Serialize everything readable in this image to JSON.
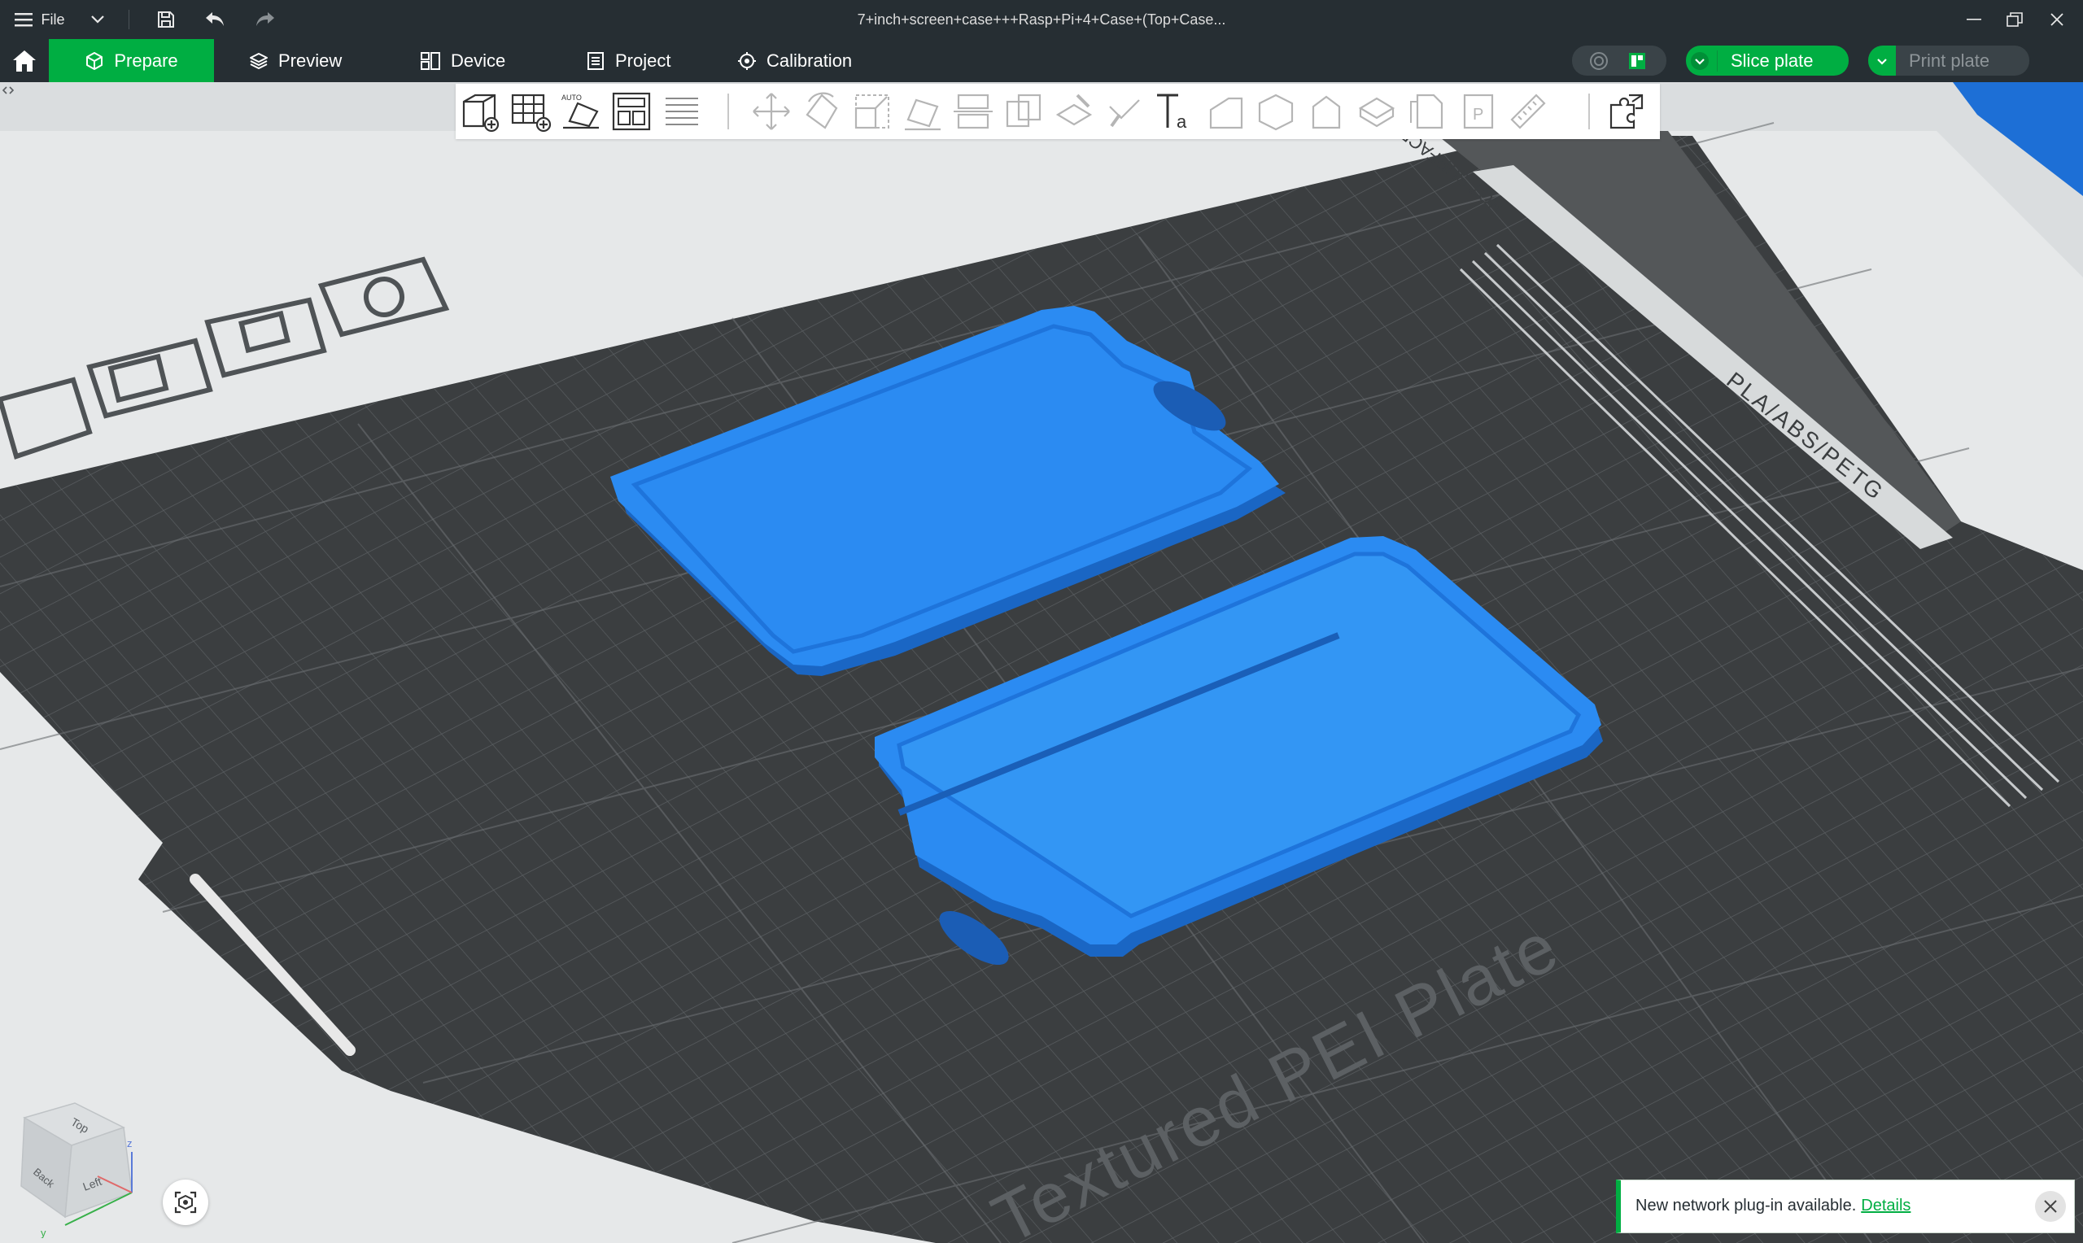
{
  "titlebar": {
    "menu_label": "File",
    "document_title": "7+inch+screen+case+++Rasp+Pi+4+Case+(Top+Case..."
  },
  "tabs": [
    {
      "label": "Prepare",
      "icon": "cube-icon",
      "active": true
    },
    {
      "label": "Preview",
      "icon": "layers-icon",
      "active": false
    },
    {
      "label": "Device",
      "icon": "device-icon",
      "active": false
    },
    {
      "label": "Project",
      "icon": "project-icon",
      "active": false
    },
    {
      "label": "Calibration",
      "icon": "calibration-icon",
      "active": false
    }
  ],
  "actions": {
    "slice_label": "Slice plate",
    "print_label": "Print plate"
  },
  "plate": {
    "name_text": "Textured PEI Plate",
    "material_text": "PLA/ABS/PETG",
    "warning_text": "HOT SURFACE"
  },
  "notification": {
    "message": "New network plug-in available.",
    "link_text": "Details"
  },
  "viewcube": {
    "face_top": "Top",
    "face_left": "Left",
    "face_back": "Back",
    "axis_z": "z",
    "axis_y": "y"
  },
  "colors": {
    "accent": "#00ae42",
    "titlebar": "#262e33",
    "plate": "#3a3d3f",
    "model": "#2b8bf2"
  }
}
